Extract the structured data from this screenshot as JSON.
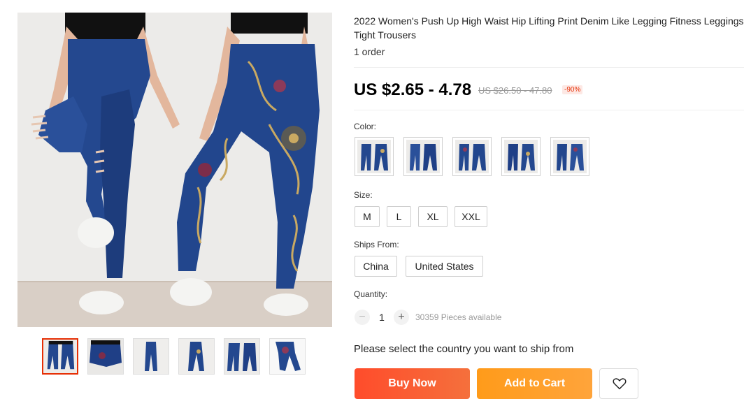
{
  "product": {
    "title": "2022 Women's Push Up High Waist Hip Lifting Print Denim Like Legging Fitness Leggings Tight Trousers",
    "orders": "1 order",
    "price": "US $2.65 - 4.78",
    "original_price": "US $26.50 - 47.80",
    "discount": "-90%"
  },
  "gallery": {
    "main_image": "leggings-photo",
    "thumbnails": [
      "thumb-1",
      "thumb-2",
      "thumb-3",
      "thumb-4",
      "thumb-5",
      "thumb-6"
    ],
    "selected_index": 0
  },
  "color": {
    "label": "Color:",
    "swatches": [
      "swatch-1",
      "swatch-2",
      "swatch-3",
      "swatch-4",
      "swatch-5"
    ]
  },
  "size": {
    "label": "Size:",
    "options": [
      "M",
      "L",
      "XL",
      "XXL"
    ]
  },
  "ships_from": {
    "label": "Ships From:",
    "options": [
      "China",
      "United States"
    ]
  },
  "quantity": {
    "label": "Quantity:",
    "minus": "−",
    "plus": "+",
    "value": "1",
    "available": "30359 Pieces available"
  },
  "shipping_message": "Please select the country you want to ship from",
  "actions": {
    "buy_now": "Buy Now",
    "add_to_cart": "Add to Cart"
  },
  "colors": {
    "accent_red": "#e62e04",
    "buy_now_start": "#ff4c2b",
    "add_to_cart_start": "#ff9b1a",
    "denim": "#1f3f86"
  }
}
